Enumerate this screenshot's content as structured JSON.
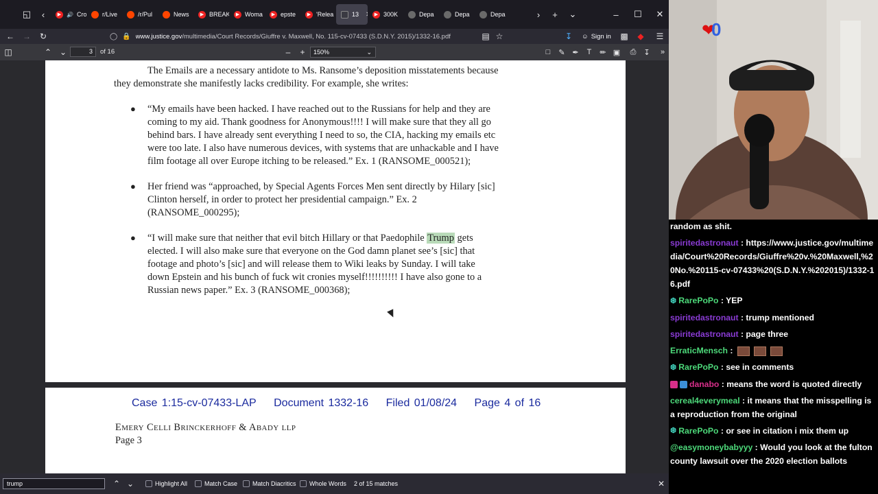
{
  "tabs": [
    {
      "label": "Crossf",
      "icon": "youtube-icon",
      "kind": "yt"
    },
    {
      "label": "r/Live",
      "icon": "reddit-icon",
      "kind": "rd"
    },
    {
      "label": "/r/Pul",
      "icon": "reddit-icon",
      "kind": "rd"
    },
    {
      "label": "News",
      "icon": "reddit-icon",
      "kind": "rd"
    },
    {
      "label": "BREAK",
      "icon": "youtube-icon",
      "kind": "yt"
    },
    {
      "label": "Woma",
      "icon": "youtube-icon",
      "kind": "yt"
    },
    {
      "label": "epste",
      "icon": "youtube-icon",
      "kind": "yt"
    },
    {
      "label": "'Relea",
      "icon": "youtube-icon",
      "kind": "yt"
    },
    {
      "label": "13",
      "icon": "pdf-icon",
      "kind": "doc",
      "active": true
    },
    {
      "label": "300K",
      "icon": "youtube-icon",
      "kind": "yt"
    },
    {
      "label": "Depa",
      "icon": "doj-icon",
      "kind": "dj"
    },
    {
      "label": "Depa",
      "icon": "doj-icon",
      "kind": "dj"
    },
    {
      "label": "Depa",
      "icon": "doj-icon",
      "kind": "dj"
    }
  ],
  "url": {
    "domain": "www.justice.gov",
    "path": "/multimedia/Court Records/Giuffre v. Maxwell, No. 115-cv-07433 (S.D.N.Y. 2015)/1332-16.pdf"
  },
  "account": {
    "sign_in": "Sign in"
  },
  "pdf": {
    "page_number": "3",
    "page_count": "of 16",
    "zoom": "150%"
  },
  "document": {
    "intro_1": "The Emails are a necessary antidote to Ms. Ransome’s deposition misstatements because",
    "intro_2": "they demonstrate she manifestly lacks credibility.  For example, she writes:",
    "b1_l1": "“My emails have been hacked. I have reached out to the Russians for help and they are",
    "b1_l2": "coming to my aid.  Thank goodness for Anonymous!!!! I will make sure that they all go",
    "b1_l3": "behind bars.  I have already sent everything I need to so, the CIA, hacking my emails etc",
    "b1_l4": "were too late.  I also have numerous devices, with systems that are unhackable and I have",
    "b1_l5": "film footage all over Europe itching to be released.” Ex. 1 (RANSOME_000521);",
    "b2_l1": "Her friend was “approached, by Special Agents Forces Men sent directly by Hilary [sic]",
    "b2_l2": "Clinton herself, in order to protect her presidential campaign.” Ex. 2",
    "b2_l3": "(RANSOME_000295);",
    "b3_l1_a": "“I will make sure that neither that evil bitch Hillary or that Paedophile",
    "b3_l1_hl": "Trump",
    "b3_l1_b": "gets",
    "b3_l2": "elected.  I will also make sure that everyone on the God damn planet see’s [sic] that",
    "b3_l3": "footage and photo’s [sic] and will release them to Wiki leaks by Sunday.  I will take",
    "b3_l4": "down Epstein and his bunch of fuck wit cronies myself!!!!!!!!!!  I have also gone to a",
    "b3_l5": "Russian news paper.” Ex. 3 (RANSOME_000368);",
    "header_case": "Case 1:15-cv-07433-LAP",
    "header_doc": "Document 1332-16",
    "header_filed": "Filed 01/08/24",
    "header_page": "Page 4 of 16",
    "firm_E": "E",
    "firm_mery": "MERY",
    "firm_C": "C",
    "firm_elli": "ELLI",
    "firm_B": "B",
    "firm_rinck": "RINCKERHOFF",
    "firm_amp": "&",
    "firm_A": "A",
    "firm_bady": "BADY",
    "firm_llp": "LLP",
    "page_label": "Page 3"
  },
  "findbar": {
    "query": "trump",
    "highlight_all": "Highlight All",
    "match_case": "Match Case",
    "match_diacritics": "Match Diacritics",
    "whole_words": "Whole Words",
    "result": "2 of 15 matches"
  },
  "chat": [
    {
      "user": "",
      "text": "random as shit.",
      "color": "#ffffff"
    },
    {
      "user": "spiritedastronaut",
      "text": "https://www.justice.gov/multimedia/Court%20Records/Giuffre%20v.%20Maxwell,%20No.%20115-cv-07433%20(S.D.N.Y.%202015)/1332-16.pdf",
      "color": "#8a3bd4"
    },
    {
      "user": "RarePoPo",
      "text": "YEP",
      "color": "#4dd97a",
      "badge": "gear"
    },
    {
      "user": "spiritedastronaut",
      "text": "trump mentioned",
      "color": "#8a3bd4"
    },
    {
      "user": "spiritedastronaut",
      "text": "page three",
      "color": "#8a3bd4"
    },
    {
      "user": "ErraticMensch",
      "text": "",
      "color": "#4dd97a",
      "emotes": 3
    },
    {
      "user": "RarePoPo",
      "text": "see in comments",
      "color": "#4dd97a",
      "badge": "gear"
    },
    {
      "user": "danabo",
      "text": "means the word is quoted directly",
      "color": "#d82f8a",
      "badge": "two"
    },
    {
      "user": "cereal4everymeal",
      "text": "it means that the misspelling is a reproduction from the original",
      "color": "#4dd97a"
    },
    {
      "user": "RarePoPo",
      "text": "or see in citation i mix them up",
      "color": "#4dd97a",
      "badge": "gear"
    },
    {
      "user": "@easymoneybabyyy",
      "text": "Would you look at the fulton county lawsuit over the 2020 election ballots",
      "color": "#4dd97a"
    }
  ],
  "overlay_icon": "heart-zero-logo"
}
